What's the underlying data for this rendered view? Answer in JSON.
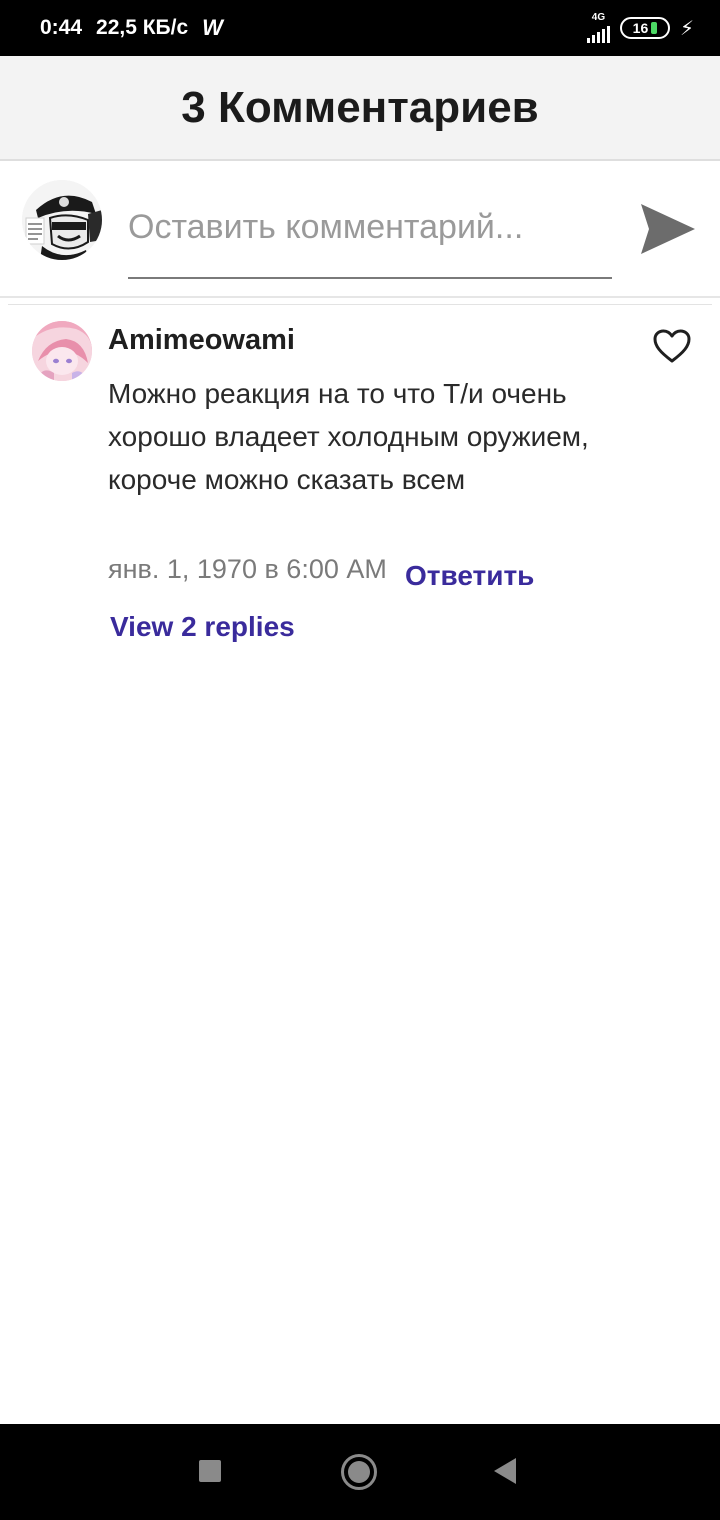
{
  "status_bar": {
    "time": "0:44",
    "speed": "22,5 КБ/с",
    "app_icon": "wattpad-w-icon",
    "network_type": "4G",
    "battery_level": "16"
  },
  "header": {
    "title": "3 Комментариев"
  },
  "composer": {
    "placeholder": "Оставить комментарий...",
    "send_icon": "send-icon"
  },
  "comment": {
    "author": "Amimeowami",
    "text": "Можно реакция на то что Т/и очень хорошо владеет холодным оружием, короче можно сказать всем",
    "date": "янв. 1, 1970 в 6:00 AM",
    "reply_label": "Ответить",
    "view_replies_label": "View 2 replies",
    "like_icon": "heart-outline-icon"
  },
  "colors": {
    "accent": "#3a2b9c",
    "header_bg": "#f3f3f3",
    "battery_level": "#4cd964"
  }
}
